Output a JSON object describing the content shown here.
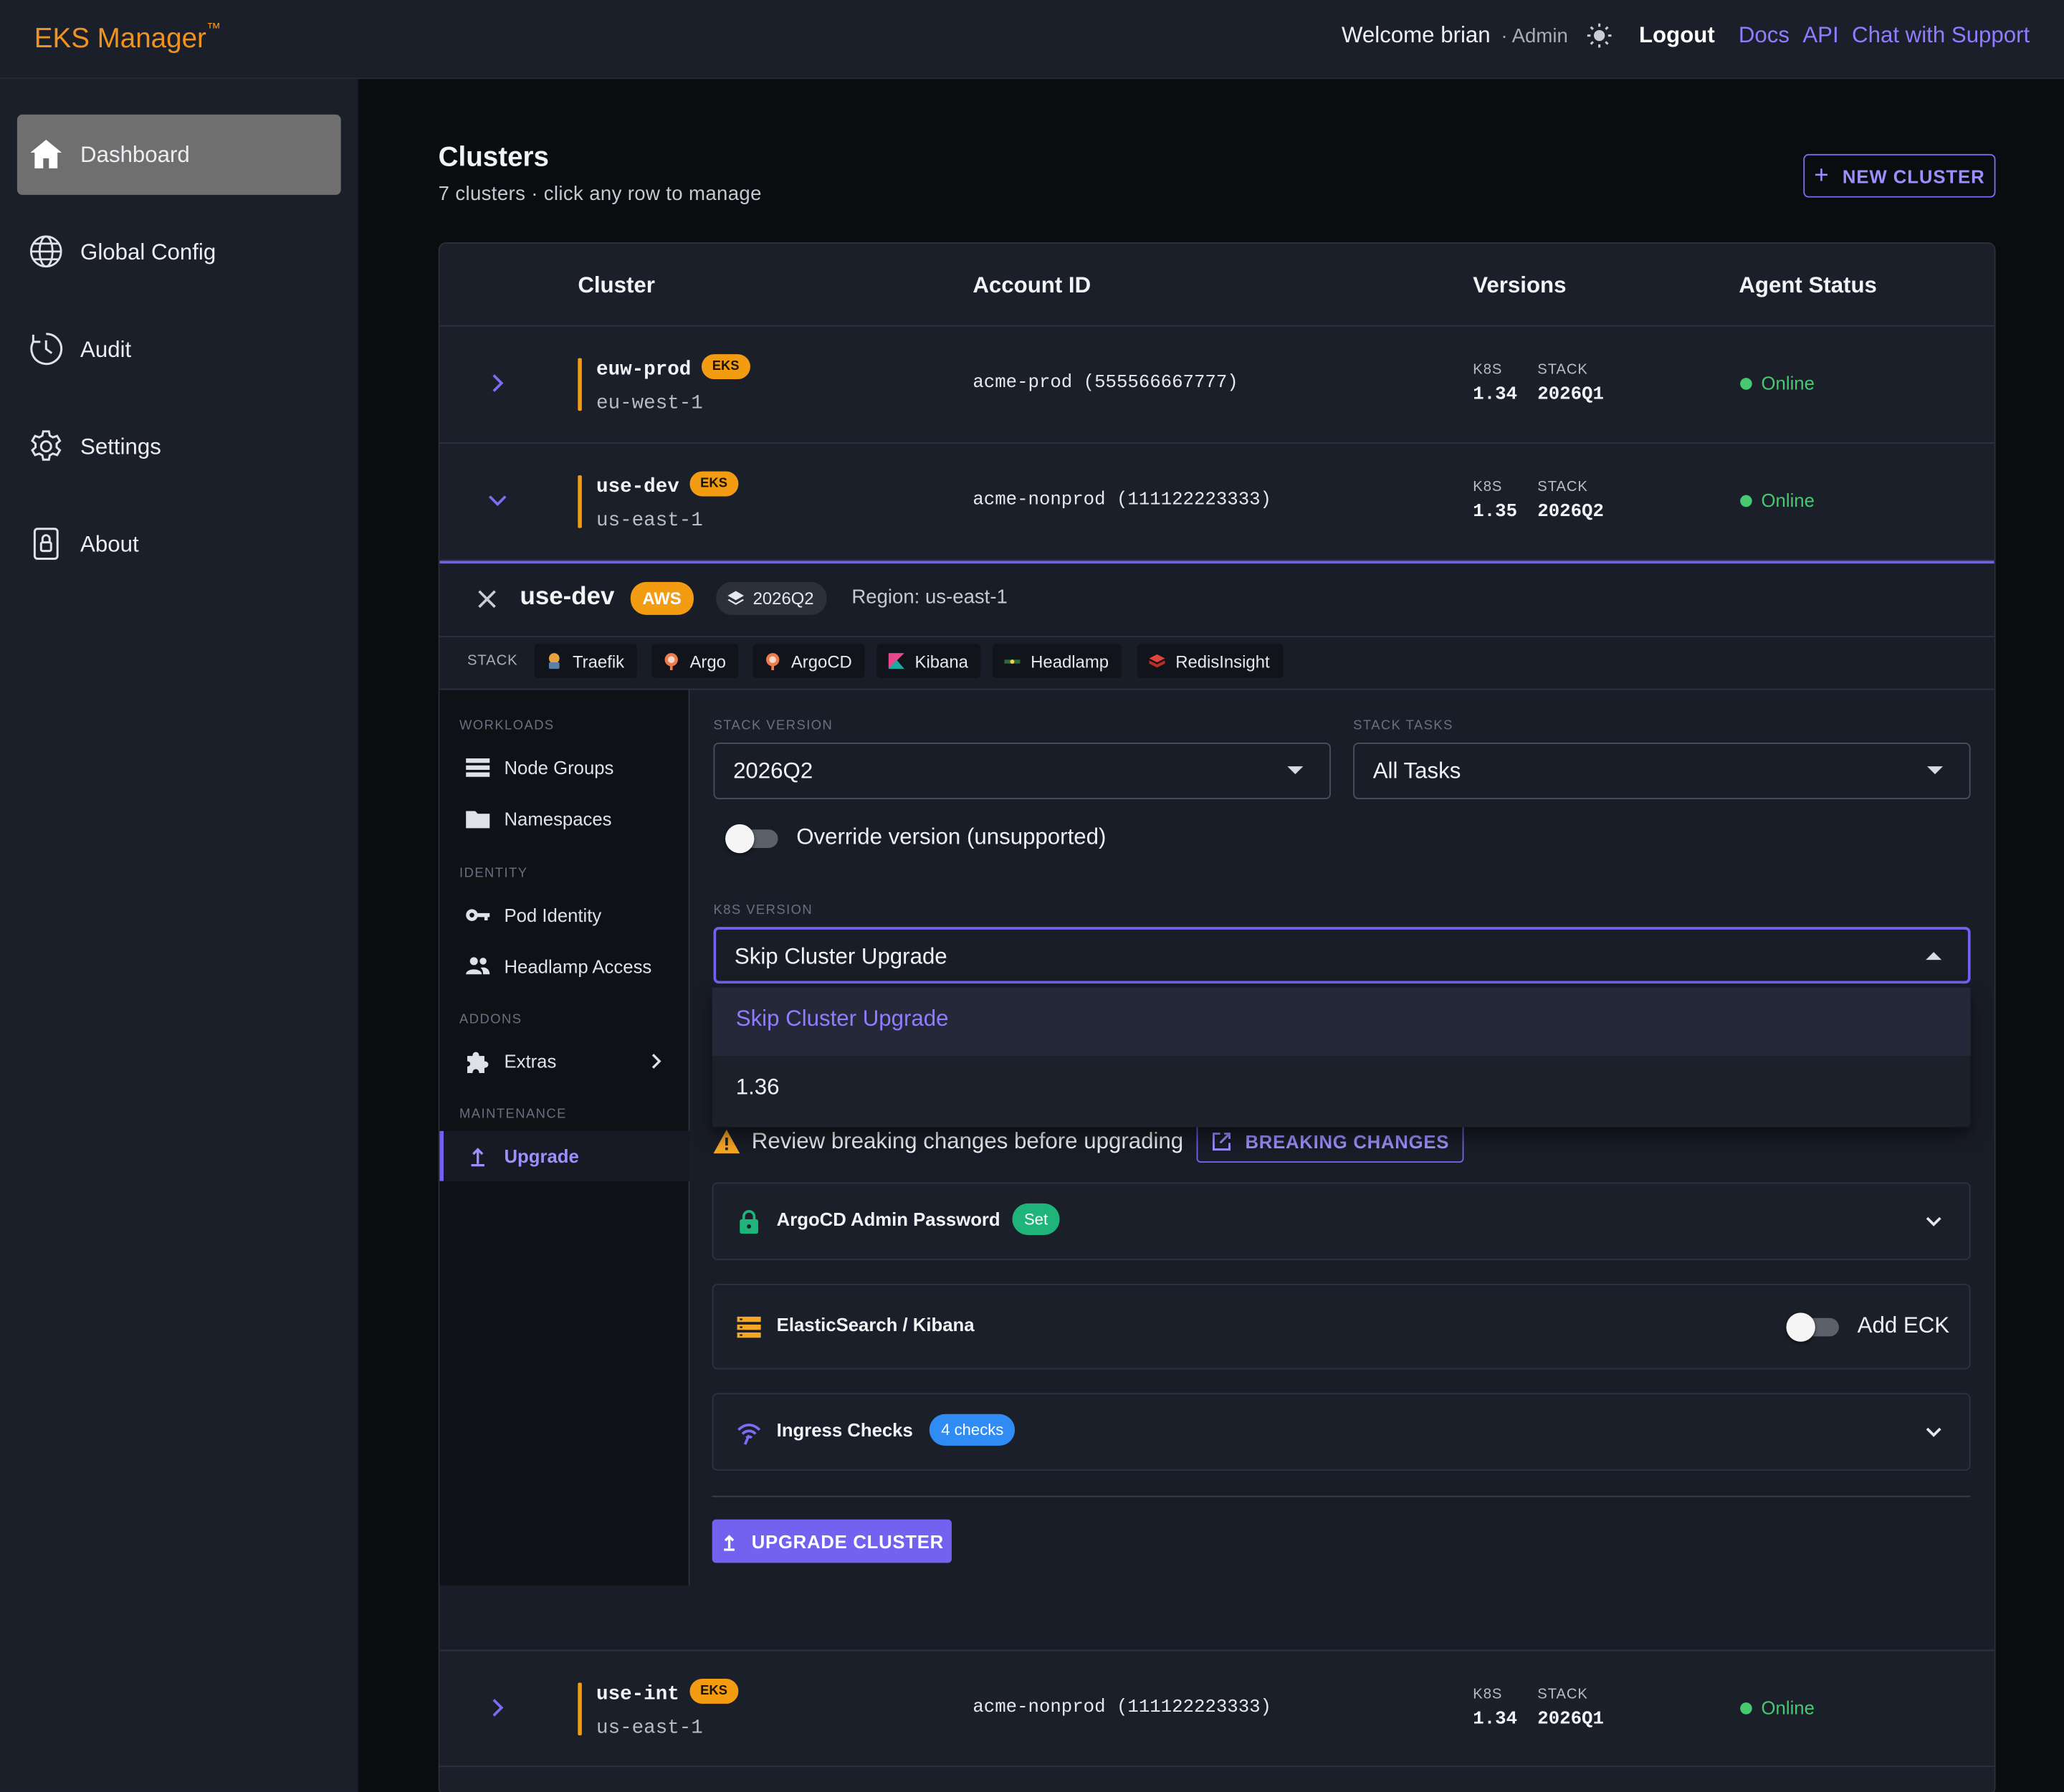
{
  "app": {
    "brand": "EKS Manager",
    "brand_tm": "™"
  },
  "topbar": {
    "welcome": "Welcome brian",
    "role": "· Admin",
    "logout": "Logout",
    "links": [
      "Docs",
      "API",
      "Chat with Support"
    ]
  },
  "sidebar": {
    "items": [
      {
        "label": "Dashboard",
        "icon": "home-icon",
        "active": true
      },
      {
        "label": "Global Config",
        "icon": "globe-icon"
      },
      {
        "label": "Audit",
        "icon": "clock-icon"
      },
      {
        "label": "Settings",
        "icon": "gear-icon"
      },
      {
        "label": "About",
        "icon": "lock-icon"
      }
    ]
  },
  "main": {
    "title": "Clusters",
    "subtitle": "7 clusters · click any row to manage",
    "new_button": "NEW CLUSTER"
  },
  "table": {
    "headers": [
      "Cluster",
      "Account ID",
      "Versions",
      "Agent Status"
    ],
    "rows": [
      {
        "name": "euw-prod",
        "badge": "EKS",
        "region": "eu-west-1",
        "account": "acme-prod (555566667777)",
        "k8s_label": "K8S",
        "k8s": "1.34",
        "stack_label": "STACK",
        "stack": "2026Q1",
        "status": "Online",
        "expanded": false
      },
      {
        "name": "use-dev",
        "badge": "EKS",
        "region": "us-east-1",
        "account": "acme-nonprod (111122223333)",
        "k8s_label": "K8S",
        "k8s": "1.35",
        "stack_label": "STACK",
        "stack": "2026Q2",
        "status": "Online",
        "expanded": true
      },
      {
        "name": "use-int",
        "badge": "EKS",
        "region": "us-east-1",
        "account": "acme-nonprod (111122223333)",
        "k8s_label": "K8S",
        "k8s": "1.34",
        "stack_label": "STACK",
        "stack": "2026Q1",
        "status": "Online",
        "expanded": false
      }
    ]
  },
  "detail": {
    "name": "use-dev",
    "provider": "AWS",
    "version_chip": "2026Q2",
    "region": "Region: us-east-1",
    "stack_label": "STACK",
    "stack_tools": [
      "Traefik",
      "Argo",
      "ArgoCD",
      "Kibana",
      "Headlamp",
      "RedisInsight"
    ],
    "subnav": {
      "workloads": "WORKLOADS",
      "node_groups": "Node Groups",
      "namespaces": "Namespaces",
      "identity": "IDENTITY",
      "pod_identity": "Pod Identity",
      "headlamp_access": "Headlamp Access",
      "addons": "ADDONS",
      "extras": "Extras",
      "maintenance": "MAINTENANCE",
      "upgrade": "Upgrade"
    },
    "form": {
      "stack_version_label": "STACK VERSION",
      "stack_version": "2026Q2",
      "stack_tasks_label": "STACK TASKS",
      "stack_tasks": "All Tasks",
      "override_label": "Override version (unsupported)",
      "override_on": false,
      "k8s_version_label": "K8S VERSION",
      "k8s_version": "Skip Cluster Upgrade",
      "k8s_options": [
        "Skip Cluster Upgrade",
        "1.36"
      ],
      "warning": "Review breaking changes before upgrading",
      "breaking_button": "BREAKING CHANGES",
      "argocd_title": "ArgoCD Admin Password",
      "argocd_chip": "Set",
      "es_title": "ElasticSearch / Kibana",
      "es_toggle_label": "Add ECK",
      "es_toggle_on": false,
      "ingress_title": "Ingress Checks",
      "ingress_chip": "4 checks",
      "upgrade_button": "UPGRADE CLUSTER"
    }
  },
  "colors": {
    "accent": "#7361f0",
    "brand": "#f0921f",
    "eks_badge": "#f39c12",
    "online": "#46c96f",
    "set_chip": "#1fb57a",
    "checks_chip": "#2f8cf5"
  }
}
